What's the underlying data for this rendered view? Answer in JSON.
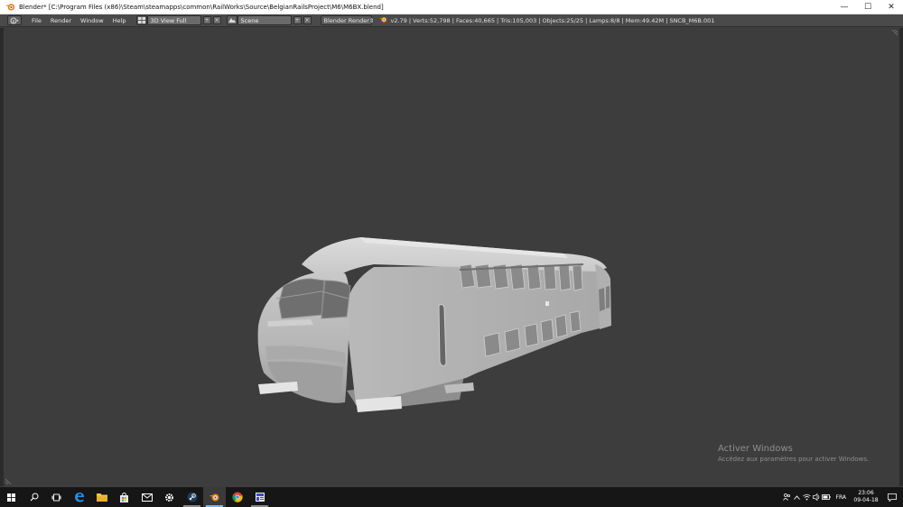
{
  "window": {
    "title": "Blender* [C:\\Program Files (x86)\\Steam\\steamapps\\common\\RailWorks\\Source\\BelgianRailsProject\\M6\\M6BX.blend]",
    "minimize": "—",
    "maximize": "☐",
    "close": "✕"
  },
  "menu": {
    "items": [
      "File",
      "Render",
      "Window",
      "Help"
    ]
  },
  "layout": {
    "screen_name": "3D View Full"
  },
  "scene": {
    "name": "Scene"
  },
  "render_engine": {
    "selected": "Blender Render",
    "arrows": "⇕"
  },
  "stats": {
    "text": "v2.79 | Verts:52,798 | Faces:40,665 | Tris:105,003 | Objects:25/25 | Lamps:8/8 | Mem:49.42M | SNCB_M6B.001"
  },
  "watermark": {
    "title": "Activer Windows",
    "subtitle": "Accédez aux paramètres pour activer Windows."
  },
  "tray": {
    "language": "FRA",
    "time": "23:06",
    "date": "09-04-18"
  },
  "icons": {
    "windows": "windows-logo-icon",
    "search": "search-icon",
    "taskview": "task-view-icon",
    "edge": "edge-browser-icon",
    "explorer": "file-explorer-icon",
    "store": "store-icon",
    "mail": "mail-icon",
    "settings": "settings-icon",
    "steam": "steam-icon",
    "blender": "blender-icon",
    "chrome": "chrome-icon",
    "app": "app-icon"
  },
  "colors": {
    "viewport_bg": "#3d3d3d",
    "header_bg": "#4a4a4a",
    "taskbar_bg": "#161616",
    "accent": "#76b9ed",
    "blender_orange": "#e87d0d"
  }
}
